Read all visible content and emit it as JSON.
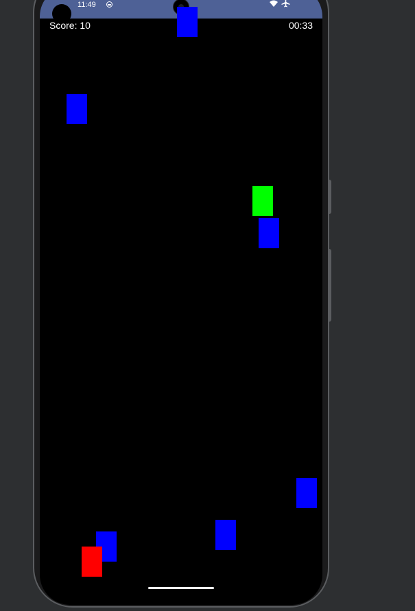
{
  "status_bar": {
    "time": "11:49",
    "color": "#4e6196",
    "icons": [
      "app-notification-icon",
      "wifi-icon",
      "airplane-mode-icon"
    ]
  },
  "hud": {
    "score": "Score: 10",
    "timer": "00:33"
  },
  "game": {
    "background": "#000000",
    "colors": {
      "obstacle": "#0000ff",
      "bonus": "#00ff00",
      "player": "#ff0000"
    },
    "blocks": [
      {
        "kind": "obstacle"
      },
      {
        "kind": "obstacle"
      },
      {
        "kind": "bonus"
      },
      {
        "kind": "obstacle"
      },
      {
        "kind": "obstacle"
      },
      {
        "kind": "obstacle"
      },
      {
        "kind": "obstacle"
      },
      {
        "kind": "player"
      }
    ]
  }
}
